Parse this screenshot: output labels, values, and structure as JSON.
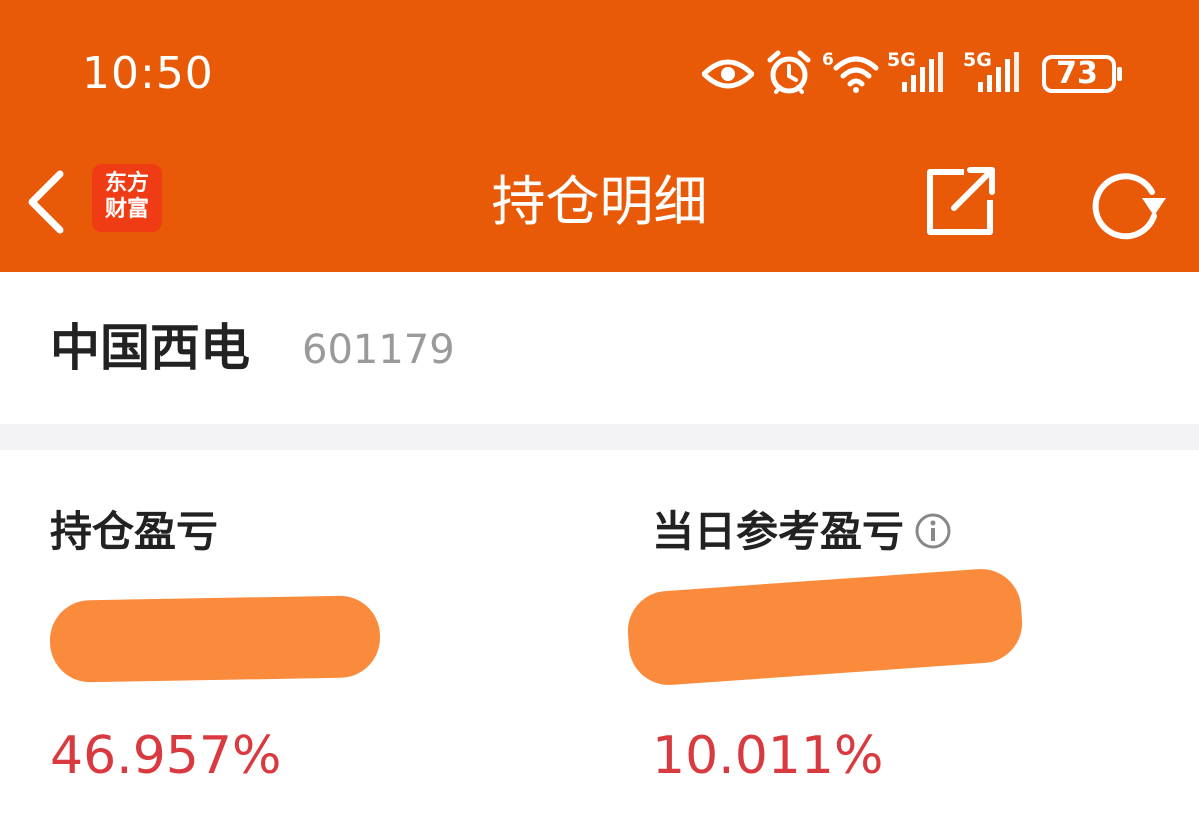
{
  "status_bar": {
    "time": "10:50",
    "battery_level": "73",
    "network_1": "5G",
    "network_2": "5G",
    "wifi_badge": "6"
  },
  "nav": {
    "title": "持仓明细",
    "brand_line1": "东方",
    "brand_line2": "财富"
  },
  "stock": {
    "name": "中国西电",
    "code": "601179"
  },
  "pnl": {
    "position_label": "持仓盈亏",
    "position_amount": "",
    "position_percent": "46.957%",
    "daily_label": "当日参考盈亏",
    "daily_amount": "",
    "daily_percent": "10.011%"
  },
  "colors": {
    "header_bg": "#e85a08",
    "profit_red": "#d93a3f",
    "redaction_orange": "#fa8a3c",
    "brand_red": "#f03c15"
  }
}
